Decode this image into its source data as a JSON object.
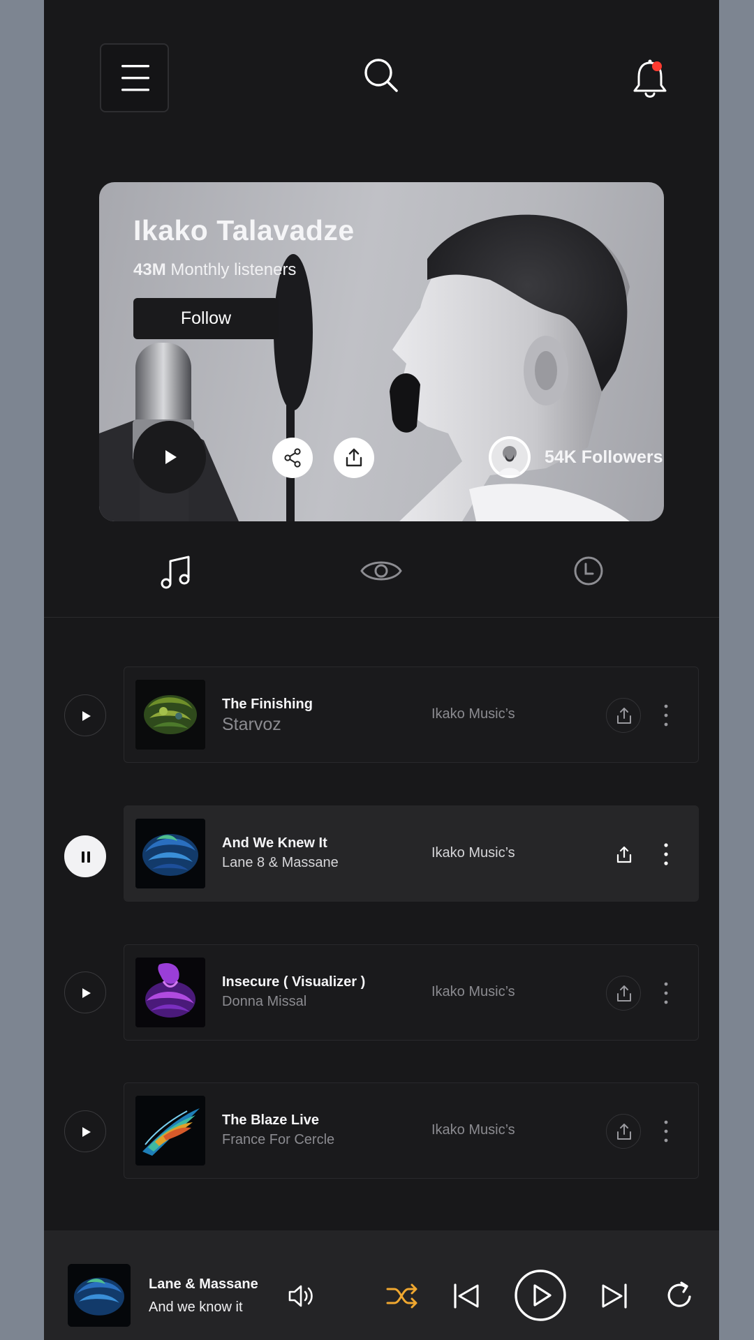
{
  "header": {
    "menu_icon": "hamburger-menu-icon",
    "search_icon": "search-icon",
    "notifications_icon": "bell-icon",
    "notification_dot_color": "#ff3b30"
  },
  "artist": {
    "name": "Ikako Talavadze",
    "listeners_count": "43M",
    "listeners_label": "Monthly listeners",
    "follow_label": "Follow",
    "followers": "54K Followers"
  },
  "tabs": [
    {
      "name": "music",
      "icon": "music-note-icon"
    },
    {
      "name": "views",
      "icon": "eye-icon"
    },
    {
      "name": "recent",
      "icon": "clock-icon"
    }
  ],
  "tracks": [
    {
      "title": "The Finishing",
      "artist": "Starvoz",
      "label": "Ikako Music’s",
      "state": "stopped"
    },
    {
      "title": "And We Knew It",
      "artist": "Lane 8 & Massane",
      "label": "Ikako Music’s",
      "state": "playing"
    },
    {
      "title": "Insecure ( Visualizer )",
      "artist": "Donna Missal",
      "label": "Ikako Music’s",
      "state": "stopped"
    },
    {
      "title": "The Blaze Live",
      "artist": "France For Cercle",
      "label": "Ikako Music’s",
      "state": "stopped"
    }
  ],
  "player": {
    "artist": "Lane & Massane",
    "track": "And we know it",
    "shuffle_color": "#f0a830"
  },
  "colors": {
    "background": "#18181a",
    "card_active": "#262628",
    "accent": "#f0a830",
    "text_primary": "#f5f5f7",
    "text_secondary": "#8b8b90"
  }
}
